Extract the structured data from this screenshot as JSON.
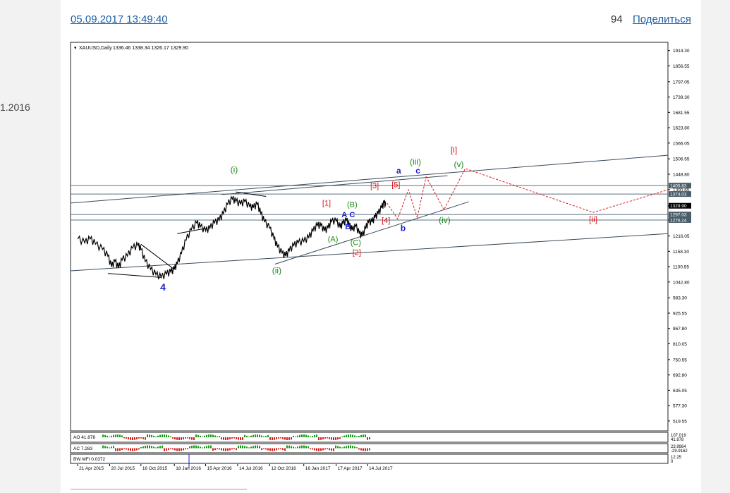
{
  "page": {
    "left_date_fragment": "1.2016",
    "post_date": "05.09.2017 13:49:40",
    "views": "94",
    "share_label": "Поделиться"
  },
  "colors": {
    "price": "#000000",
    "green": "#1a8a1a",
    "red": "#d81b1b",
    "blue": "#1a1ad8",
    "channel": "#3a4a5a",
    "hline": "#5a7080"
  },
  "chart_data": {
    "type": "line",
    "title": "XAUUSD,Daily",
    "ohlc_header": "1336.46 1338.34 1326.17 1329.90",
    "xlabel": "",
    "ylabel": "",
    "ylim": [
      490,
      1940
    ],
    "y_ticks": [
      "1914.30",
      "1856.55",
      "1797.05",
      "1739.30",
      "1681.55",
      "1623.80",
      "1566.05",
      "1506.55",
      "1448.80",
      "1390.65",
      "1329.90",
      "1276.24",
      "1216.05",
      "1158.30",
      "1100.55",
      "1042.80",
      "983.30",
      "925.55",
      "867.80",
      "810.05",
      "750.55",
      "692.80",
      "635.05",
      "577.30",
      "519.55"
    ],
    "x_ticks": [
      "21 Apr 2015",
      "20 Jul 2015",
      "16 Oct 2015",
      "18 Jan 2016",
      "15 Apr 2016",
      "14 Jul 2016",
      "12 Oct 2016",
      "16 Jan 2017",
      "17 Apr 2017",
      "14 Jul 2017"
    ],
    "x_tick_values": [
      0,
      90,
      178,
      272,
      360,
      450,
      540,
      636,
      727,
      815
    ],
    "x_range": [
      -20,
      1660
    ],
    "price_series": [
      [
        0,
        1205
      ],
      [
        20,
        1190
      ],
      [
        35,
        1205
      ],
      [
        50,
        1185
      ],
      [
        70,
        1165
      ],
      [
        85,
        1140
      ],
      [
        95,
        1100
      ],
      [
        105,
        1120
      ],
      [
        115,
        1095
      ],
      [
        125,
        1125
      ],
      [
        140,
        1140
      ],
      [
        155,
        1170
      ],
      [
        170,
        1180
      ],
      [
        178,
        1165
      ],
      [
        190,
        1120
      ],
      [
        205,
        1090
      ],
      [
        220,
        1070
      ],
      [
        235,
        1060
      ],
      [
        250,
        1072
      ],
      [
        262,
        1080
      ],
      [
        272,
        1090
      ],
      [
        280,
        1110
      ],
      [
        292,
        1150
      ],
      [
        305,
        1200
      ],
      [
        320,
        1240
      ],
      [
        335,
        1265
      ],
      [
        345,
        1250
      ],
      [
        360,
        1235
      ],
      [
        372,
        1245
      ],
      [
        385,
        1265
      ],
      [
        398,
        1275
      ],
      [
        410,
        1300
      ],
      [
        422,
        1335
      ],
      [
        435,
        1355
      ],
      [
        445,
        1345
      ],
      [
        458,
        1335
      ],
      [
        470,
        1345
      ],
      [
        484,
        1325
      ],
      [
        494,
        1322
      ],
      [
        505,
        1335
      ],
      [
        515,
        1300
      ],
      [
        525,
        1270
      ],
      [
        540,
        1245
      ],
      [
        552,
        1205
      ],
      [
        562,
        1175
      ],
      [
        575,
        1150
      ],
      [
        585,
        1140
      ],
      [
        595,
        1160
      ],
      [
        608,
        1180
      ],
      [
        620,
        1190
      ],
      [
        636,
        1195
      ],
      [
        650,
        1210
      ],
      [
        662,
        1235
      ],
      [
        674,
        1255
      ],
      [
        684,
        1255
      ],
      [
        694,
        1235
      ],
      [
        704,
        1245
      ],
      [
        714,
        1270
      ],
      [
        727,
        1272
      ],
      [
        738,
        1248
      ],
      [
        746,
        1262
      ],
      [
        756,
        1275
      ],
      [
        764,
        1255
      ],
      [
        772,
        1238
      ],
      [
        782,
        1252
      ],
      [
        792,
        1225
      ],
      [
        800,
        1215
      ],
      [
        810,
        1245
      ],
      [
        818,
        1268
      ],
      [
        828,
        1268
      ],
      [
        836,
        1285
      ],
      [
        845,
        1300
      ],
      [
        855,
        1322
      ],
      [
        862,
        1340
      ],
      [
        866,
        1330
      ]
    ],
    "channel_lines": [
      {
        "from": [
          -20,
          1340
        ],
        "to": [
          1660,
          1520
        ]
      },
      {
        "from": [
          -20,
          1085
        ],
        "to": [
          1660,
          1225
        ]
      },
      {
        "from": [
          555,
          1110
        ],
        "to": [
          1100,
          1345
        ]
      },
      {
        "from": [
          405,
          1372
        ],
        "to": [
          1040,
          1443
        ]
      }
    ],
    "wedge_lines": [
      {
        "from": [
          85,
          1075
        ],
        "to": [
          235,
          1060
        ]
      },
      {
        "from": [
          178,
          1185
        ],
        "to": [
          272,
          1090
        ]
      },
      {
        "from": [
          280,
          1225
        ],
        "to": [
          360,
          1245
        ]
      },
      {
        "from": [
          445,
          1382
        ],
        "to": [
          530,
          1365
        ]
      }
    ],
    "horizontal_levels": [
      {
        "value": 1405.83,
        "label": "1405.83"
      },
      {
        "value": 1374.03,
        "label": "1374.03"
      },
      {
        "value": 1297.03,
        "label": "1297.03"
      },
      {
        "value": 1276.24,
        "label": "1276.24"
      }
    ],
    "projection_paths": [
      {
        "color": "red",
        "points": [
          [
            870,
            1340
          ],
          [
            900,
            1280
          ],
          [
            930,
            1390
          ],
          [
            955,
            1285
          ],
          [
            980,
            1440
          ]
        ]
      },
      {
        "color": "red",
        "points": [
          [
            980,
            1440
          ],
          [
            1030,
            1315
          ],
          [
            1090,
            1470
          ],
          [
            1450,
            1305
          ],
          [
            1660,
            1390
          ]
        ]
      }
    ],
    "wave_labels": [
      {
        "text": "(i)",
        "x": 440,
        "y": 1455,
        "color": "green",
        "size": 12
      },
      {
        "text": "(ii)",
        "x": 560,
        "y": 1075,
        "color": "green",
        "size": 12
      },
      {
        "text": "(iii)",
        "x": 950,
        "y": 1485,
        "color": "green",
        "size": 12
      },
      {
        "text": "(iv)",
        "x": 1032,
        "y": 1265,
        "color": "green",
        "size": 12
      },
      {
        "text": "(v)",
        "x": 1072,
        "y": 1475,
        "color": "green",
        "size": 12
      },
      {
        "text": "(A)",
        "x": 718,
        "y": 1195,
        "color": "green",
        "size": 11
      },
      {
        "text": "(B)",
        "x": 772,
        "y": 1325,
        "color": "green",
        "size": 11
      },
      {
        "text": "(C)",
        "x": 782,
        "y": 1182,
        "color": "green",
        "size": 11
      },
      {
        "text": "[1]",
        "x": 700,
        "y": 1330,
        "color": "red",
        "size": 11
      },
      {
        "text": "[2]",
        "x": 785,
        "y": 1145,
        "color": "red",
        "size": 11
      },
      {
        "text": "[3]",
        "x": 835,
        "y": 1395,
        "color": "red",
        "size": 11
      },
      {
        "text": "[4]",
        "x": 867,
        "y": 1265,
        "color": "red",
        "size": 11
      },
      {
        "text": "[5]",
        "x": 895,
        "y": 1400,
        "color": "red",
        "size": 11
      },
      {
        "text": "[i]",
        "x": 1058,
        "y": 1530,
        "color": "red",
        "size": 12
      },
      {
        "text": "[ii]",
        "x": 1450,
        "y": 1268,
        "color": "red",
        "size": 12
      },
      {
        "text": "A",
        "x": 750,
        "y": 1287,
        "color": "blue",
        "size": 11
      },
      {
        "text": "B",
        "x": 760,
        "y": 1242,
        "color": "blue",
        "size": 11
      },
      {
        "text": "C",
        "x": 772,
        "y": 1287,
        "color": "blue",
        "size": 11
      },
      {
        "text": "a",
        "x": 903,
        "y": 1452,
        "color": "blue",
        "size": 12
      },
      {
        "text": "b",
        "x": 915,
        "y": 1235,
        "color": "blue",
        "size": 12
      },
      {
        "text": "c",
        "x": 957,
        "y": 1452,
        "color": "blue",
        "size": 12
      },
      {
        "text": "4",
        "x": 240,
        "y": 1010,
        "color": "blue",
        "size": 14
      }
    ],
    "indicators": [
      {
        "label": "AO 41.878",
        "scale_top": "107.019",
        "scale_mid": "41.878"
      },
      {
        "label": "AC 7.283",
        "scale_top": "23.9984",
        "scale_mid": "-29.9162"
      },
      {
        "label": "BW MFI 0.0372",
        "scale_top": "12.25",
        "scale_mid": "0"
      }
    ]
  }
}
